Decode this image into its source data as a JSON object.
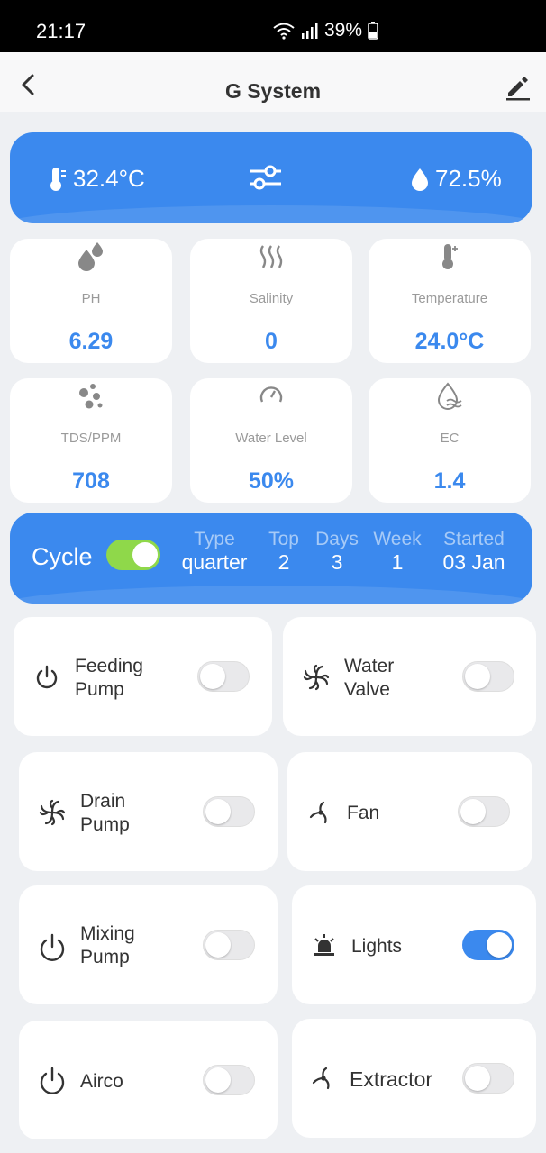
{
  "status_bar": {
    "time": "21:17",
    "battery": "39%"
  },
  "header": {
    "title": "G System"
  },
  "environment": {
    "temperature": "32.4°C",
    "humidity": "72.5%"
  },
  "sensors": [
    {
      "label": "PH",
      "value": "6.29",
      "icon": "drops-icon"
    },
    {
      "label": "Salinity",
      "value": "0",
      "icon": "heat-waves-icon"
    },
    {
      "label": "Temperature",
      "value": "24.0°C",
      "icon": "thermometer-icon"
    },
    {
      "label": "TDS/PPM",
      "value": "708",
      "icon": "bubbles-icon"
    },
    {
      "label": "Water Level",
      "value": "50%",
      "icon": "gauge-icon"
    },
    {
      "label": "EC",
      "value": "1.4",
      "icon": "water-drop-icon"
    }
  ],
  "cycle": {
    "label": "Cycle",
    "enabled": true,
    "columns": [
      {
        "header": "Type",
        "value": "quarter"
      },
      {
        "header": "Top",
        "value": "2"
      },
      {
        "header": "Days",
        "value": "3"
      },
      {
        "header": "Week",
        "value": "1"
      },
      {
        "header": "Started",
        "value": "03 Jan"
      }
    ]
  },
  "devices": [
    {
      "label_line1": "Feeding",
      "label_line2": "Pump",
      "icon": "power-icon",
      "on": false
    },
    {
      "label_line1": "Water",
      "label_line2": "Valve",
      "icon": "fan-icon",
      "on": false
    },
    {
      "label_line1": "Drain",
      "label_line2": "Pump",
      "icon": "fan-icon",
      "on": false
    },
    {
      "label_line1": "Fan",
      "label_line2": "",
      "icon": "fan-outline-icon",
      "on": false
    },
    {
      "label_line1": "Mixing",
      "label_line2": "Pump",
      "icon": "power-icon",
      "on": false
    },
    {
      "label_line1": "Lights",
      "label_line2": "",
      "icon": "alarm-light-icon",
      "on": true
    },
    {
      "label_line1": "Airco",
      "label_line2": "",
      "icon": "power-icon",
      "on": false
    },
    {
      "label_line1": "Extractor",
      "label_line2": "",
      "icon": "fan-outline-icon",
      "on": false
    }
  ],
  "colors": {
    "accent": "#3b89ee",
    "cycle_toggle": "#8fd84a",
    "background": "#eef0f3"
  }
}
